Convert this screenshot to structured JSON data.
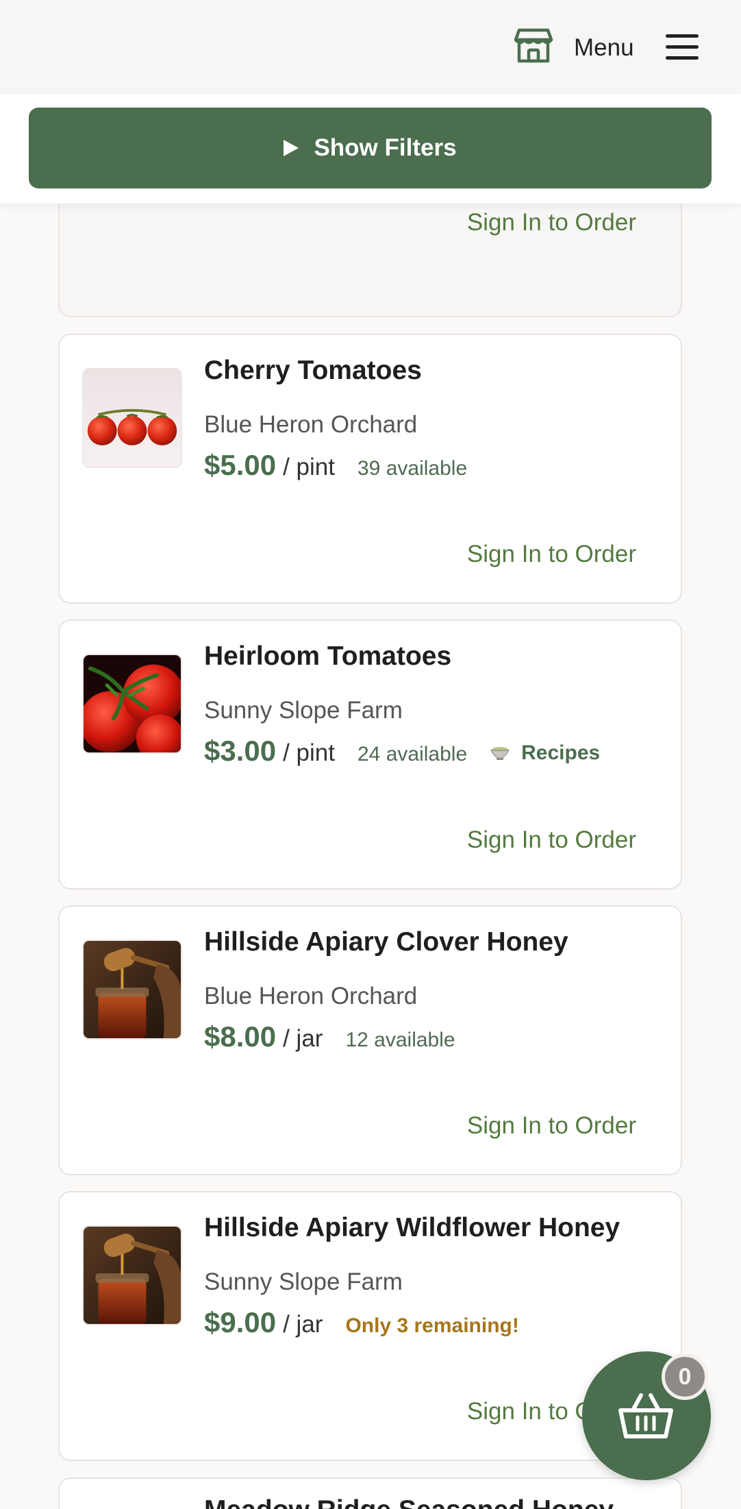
{
  "header": {
    "menu_label": "Menu"
  },
  "filters": {
    "button_label": "Show Filters"
  },
  "previous_card": {
    "sign_in_label": "Sign In to Order"
  },
  "products": [
    {
      "name": "Cherry Tomatoes",
      "farm": "Blue Heron Orchard",
      "price": "$5.00",
      "unit": "/ pint",
      "availability": "39 available",
      "sign_in_label": "Sign In to Order"
    },
    {
      "name": "Heirloom Tomatoes",
      "farm": "Sunny Slope Farm",
      "price": "$3.00",
      "unit": "/ pint",
      "availability": "24 available",
      "recipes_label": "Recipes",
      "sign_in_label": "Sign In to Order"
    },
    {
      "name": "Hillside Apiary Clover Honey",
      "farm": "Blue Heron Orchard",
      "price": "$8.00",
      "unit": "/ jar",
      "availability": "12 available",
      "sign_in_label": "Sign In to Order"
    },
    {
      "name": "Hillside Apiary Wildflower Honey",
      "farm": "Sunny Slope Farm",
      "price": "$9.00",
      "unit": "/ jar",
      "low_stock": "Only 3 remaining!",
      "sign_in_label": "Sign In to Order"
    },
    {
      "name": "Meadow Ridge Seasoned Honey"
    }
  ],
  "cart": {
    "count": "0"
  },
  "colors": {
    "brand_green": "#4a6e4e",
    "link_green": "#547a3f",
    "warning_amber": "#a7761a"
  },
  "icons": {
    "store": "store-icon",
    "menu": "hamburger-icon",
    "filters": "play-triangle-icon",
    "recipes": "bowl-icon",
    "cart": "basket-icon"
  }
}
